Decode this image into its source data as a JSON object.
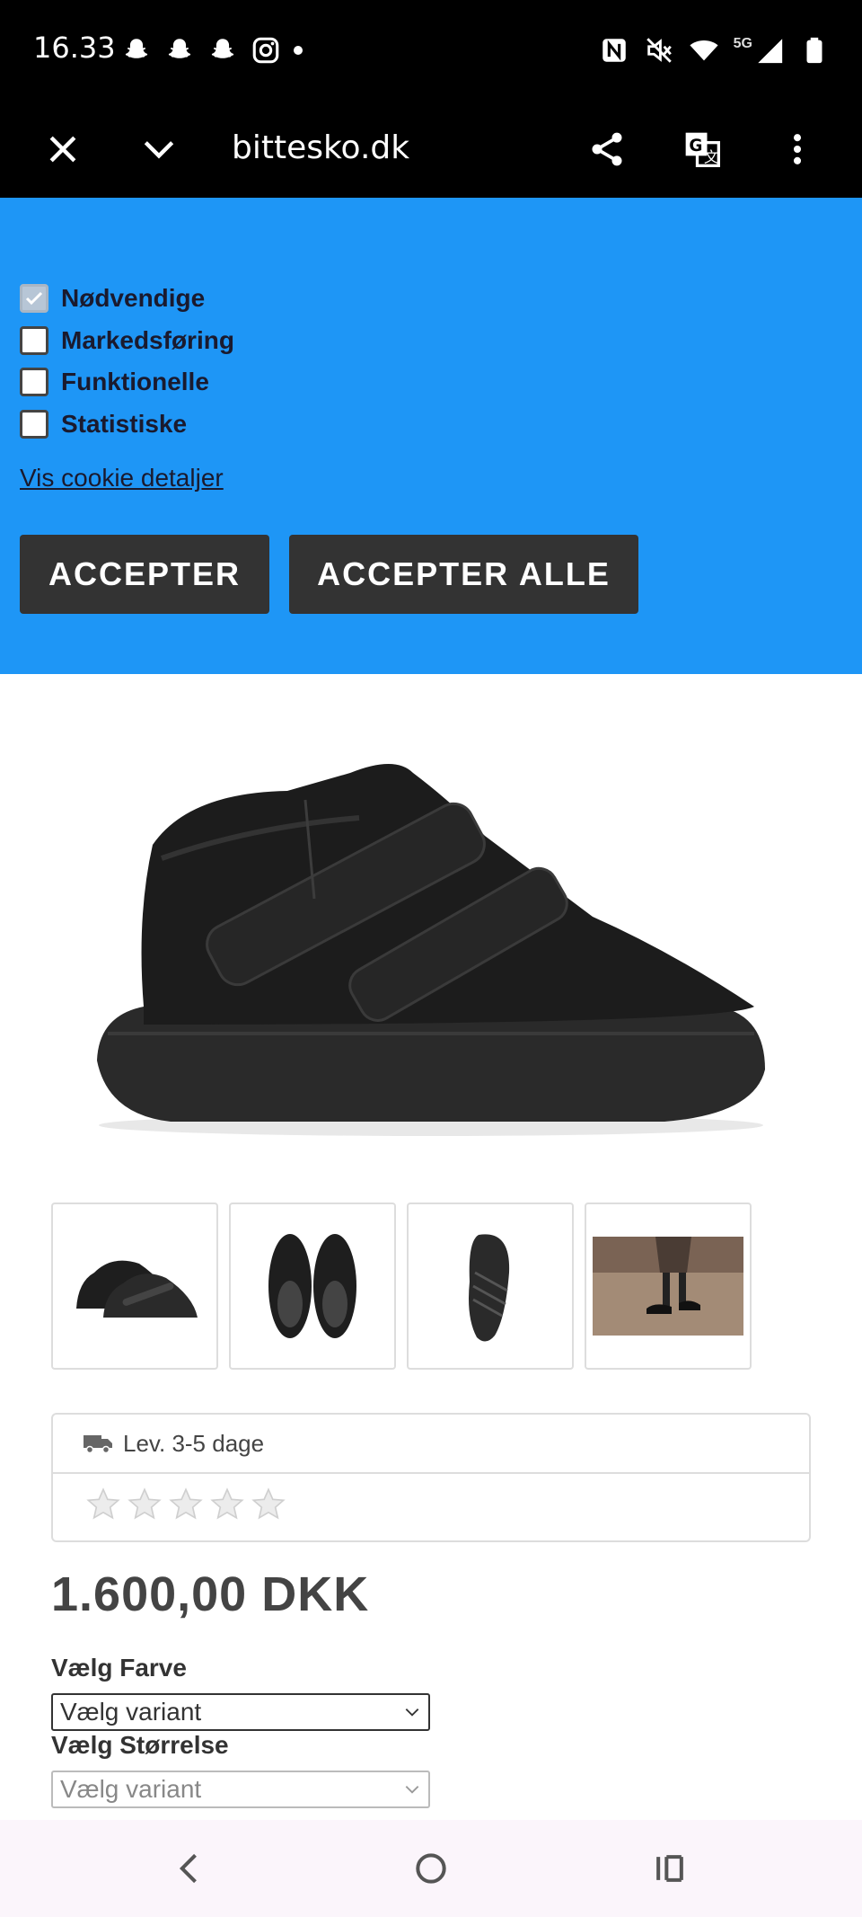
{
  "status_bar": {
    "time": "16.33",
    "network": "5G",
    "icons_left": [
      "snapchat-icon",
      "snapchat-icon",
      "snapchat-icon",
      "instagram-icon",
      "dot-icon"
    ],
    "icons_right": [
      "nfc-icon",
      "mute-icon",
      "wifi-icon",
      "signal-icon",
      "battery-icon"
    ]
  },
  "browser": {
    "url": "bittesko.dk",
    "buttons": [
      "close-icon",
      "chevron-down-icon",
      "share-icon",
      "translate-icon",
      "more-icon"
    ]
  },
  "cookie_banner": {
    "bg_color": "#1e96f6",
    "options": [
      {
        "label": "Nødvendige",
        "checked": true
      },
      {
        "label": "Markedsføring",
        "checked": false
      },
      {
        "label": "Funktionelle",
        "checked": false
      },
      {
        "label": "Statistiske",
        "checked": false
      }
    ],
    "details_link": "Vis cookie detaljer",
    "accept_label": "ACCEPTER",
    "accept_all_label": "ACCEPTER ALLE"
  },
  "product": {
    "delivery": "Lev. 3-5 dage",
    "rating": 0,
    "rating_max": 5,
    "price_amount": "1.600,00",
    "price_currency": "DKK",
    "color_label": "Vælg Farve",
    "color_select": "Vælg variant",
    "size_label": "Vælg Størrelse",
    "size_select": "Vælg variant"
  },
  "nav_bar": {
    "buttons": [
      "back-icon",
      "home-icon",
      "recents-icon"
    ]
  }
}
